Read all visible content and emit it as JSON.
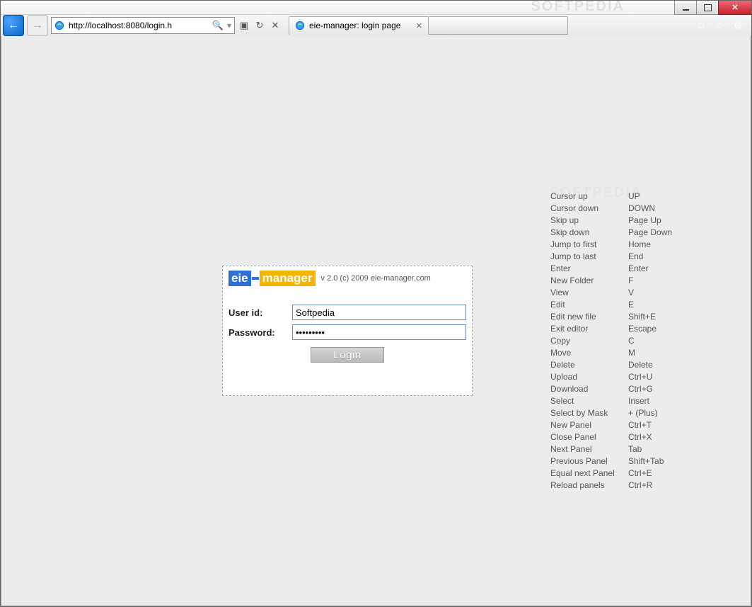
{
  "window": {
    "watermark": "SOFTPEDIA"
  },
  "toolbar": {
    "url": "http://localhost:8080/login.h",
    "search_glyph": "🔍",
    "compat_glyph": "▣",
    "refresh_glyph": "↻",
    "stop_glyph": "✕"
  },
  "tab": {
    "title": "eie-manager: login page"
  },
  "login": {
    "logo_seg1": "eie",
    "logo_seg2": "manager",
    "info": "v 2.0 (c) 2009 eie-manager.com",
    "userid_label": "User id:",
    "userid_value": "Softpedia",
    "password_label": "Password:",
    "password_value": "•••••••••",
    "button": "Login"
  },
  "shortcuts": [
    {
      "name": "Cursor up",
      "key": "UP"
    },
    {
      "name": "Cursor down",
      "key": "DOWN"
    },
    {
      "name": "Skip up",
      "key": "Page Up"
    },
    {
      "name": "Skip down",
      "key": "Page Down"
    },
    {
      "name": "Jump to first",
      "key": "Home"
    },
    {
      "name": "Jump to last",
      "key": "End"
    },
    {
      "name": "Enter",
      "key": "Enter"
    },
    {
      "name": "New Folder",
      "key": "F"
    },
    {
      "name": "View",
      "key": "V"
    },
    {
      "name": "Edit",
      "key": "E"
    },
    {
      "name": "Edit new file",
      "key": "Shift+E"
    },
    {
      "name": "Exit editor",
      "key": "Escape"
    },
    {
      "name": "Copy",
      "key": "C"
    },
    {
      "name": "Move",
      "key": "M"
    },
    {
      "name": "Delete",
      "key": "Delete"
    },
    {
      "name": "Upload",
      "key": "Ctrl+U"
    },
    {
      "name": "Download",
      "key": "Ctrl+G"
    },
    {
      "name": "Select",
      "key": "Insert"
    },
    {
      "name": "Select by Mask",
      "key": "+ (Plus)"
    },
    {
      "name": "New Panel",
      "key": "Ctrl+T"
    },
    {
      "name": "Close Panel",
      "key": "Ctrl+X"
    },
    {
      "name": "Next Panel",
      "key": "Tab"
    },
    {
      "name": "Previous Panel",
      "key": "Shift+Tab"
    },
    {
      "name": "Equal next Panel",
      "key": "Ctrl+E"
    },
    {
      "name": "Reload panels",
      "key": "Ctrl+R"
    }
  ]
}
